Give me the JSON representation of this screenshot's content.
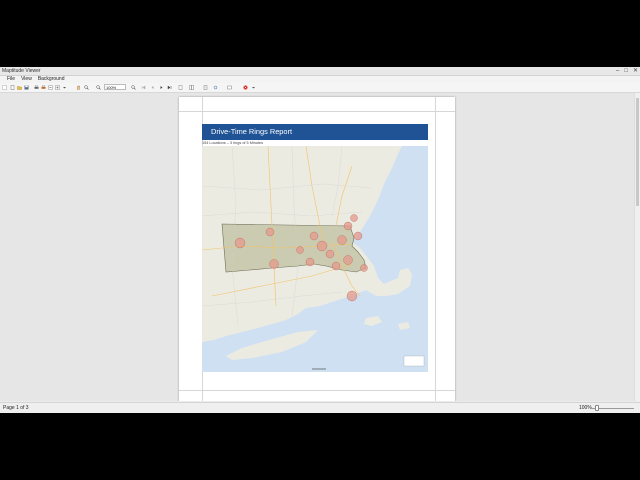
{
  "window": {
    "title": "Maptitude Viewer"
  },
  "menu": {
    "items": [
      "File",
      "View",
      "Background"
    ]
  },
  "toolbar": {
    "zoom_value": "100%"
  },
  "report": {
    "title": "Drive-Time Rings Report",
    "caption": "154 Locations – 3 rings of 5 Minutes"
  },
  "status": {
    "page": "Page 1 of 3",
    "zoom": "100%"
  },
  "colors": {
    "header": "#1f5396",
    "water": "#cfe0f2",
    "land": "#ecebe2",
    "region": "#bfc09f",
    "ring": "#e39a8c"
  },
  "icons": [
    "app-icon",
    "minimize-icon",
    "maximize-icon",
    "close-icon",
    "new-icon",
    "open-icon",
    "save-icon",
    "print-icon",
    "print-preview-icon",
    "export-icon",
    "zoom-in-icon",
    "zoom-out-icon",
    "first-page-icon",
    "prev-page-icon",
    "next-page-icon",
    "last-page-icon",
    "stop-icon"
  ]
}
